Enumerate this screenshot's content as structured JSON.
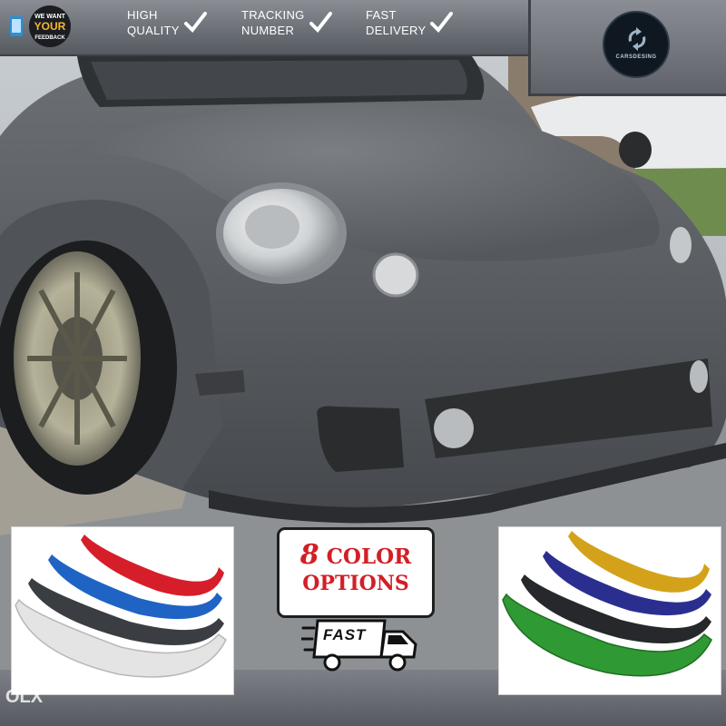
{
  "top_bar": {
    "badge": {
      "line1": "WE WANT",
      "line2": "YOUR",
      "line3": "FEEDBACK"
    },
    "features": [
      {
        "line1": "HIGH",
        "line2": "QUALITY"
      },
      {
        "line1": "TRACKING",
        "line2": "NUMBER"
      },
      {
        "line1": "FAST",
        "line2": "DELIVERY"
      }
    ]
  },
  "logo": {
    "text": "CARSDESING"
  },
  "color_options": {
    "number": "8",
    "line1_word": "COLOR",
    "line2": "OPTIONS"
  },
  "delivery_badge": {
    "label": "FAST"
  },
  "watermark": {
    "text": "OLX"
  },
  "colors": {
    "left_lips": [
      "#d61e2a",
      "#1f64c4",
      "#3a3d42",
      "#e6e6e6"
    ],
    "right_lips": [
      "#d4a21a",
      "#2a2f8f",
      "#26282b",
      "#2f9a34"
    ],
    "car_body": "#5f6367",
    "accent_red": "#d21f26"
  },
  "icons": [
    "phone-icon",
    "checkmark-icon",
    "delivery-truck-icon",
    "recycle-arrows-icon"
  ]
}
